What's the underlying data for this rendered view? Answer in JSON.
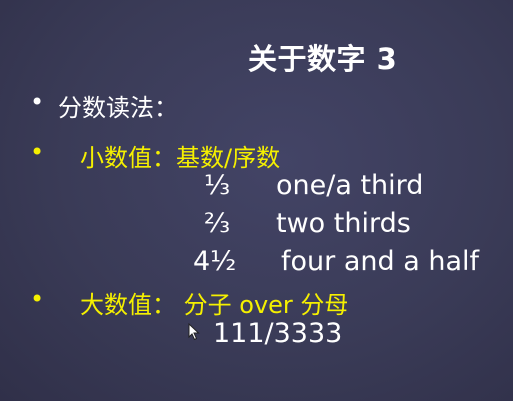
{
  "slide": {
    "title": "关于数字 3",
    "bullets": [
      {
        "marker": "•",
        "text": "分数读法："
      },
      {
        "marker": "•",
        "text": "小数值：基数/序数"
      },
      {
        "marker": "•",
        "text": "大数值： 分子 over 分母"
      }
    ],
    "examples": [
      {
        "fraction": "⅓",
        "reading": "one/a  third"
      },
      {
        "fraction": "⅔",
        "reading": "two thirds"
      },
      {
        "fraction": "4½",
        "reading": "four and a half"
      }
    ],
    "large_example": "111/3333"
  },
  "colors": {
    "background": "#3b3c58",
    "heading_text": "#ffffff",
    "highlight_text": "#f5f000"
  },
  "icons": [
    "mouse-cursor-icon"
  ]
}
